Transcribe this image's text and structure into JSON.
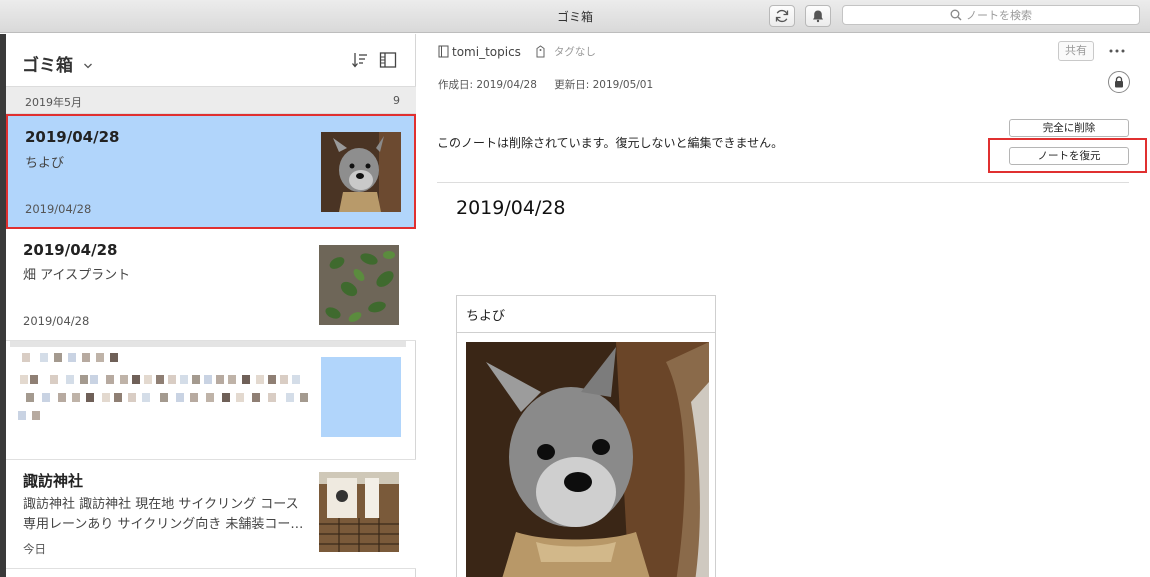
{
  "window": {
    "title": "ゴミ箱"
  },
  "toolbar": {
    "search_placeholder": "ノートを検索"
  },
  "list": {
    "title": "ゴミ箱",
    "section": {
      "label": "2019年5月",
      "count": "9"
    },
    "notes": [
      {
        "title": "2019/04/28",
        "snippet": "ちよび",
        "date": "2019/04/28"
      },
      {
        "title": "2019/04/28",
        "snippet": "畑 アイスプラント",
        "date": "2019/04/28"
      },
      {
        "title": "諏訪神社",
        "snippet": "諏訪神社 諏訪神社 現在地 サイクリング コース 専用レーンあり サイクリング向き 未舗装コー…",
        "date": "今日"
      }
    ]
  },
  "note": {
    "notebook": "tomi_topics",
    "tags": "タグなし",
    "share_label": "共有",
    "created": "作成日: 2019/04/28",
    "updated": "更新日: 2019/05/01",
    "deleted_message": "このノートは削除されています。復元しないと編集できません。",
    "delete_label": "完全に削除",
    "restore_label": "ノートを復元",
    "title": "2019/04/28",
    "table_header": "ちよび"
  },
  "colors": {
    "selected_bg": "#b1d5fb",
    "highlight": "#e03030",
    "sidebar": "#3a3a3a"
  }
}
